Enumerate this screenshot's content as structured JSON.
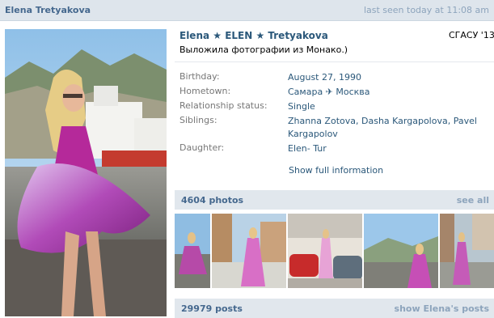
{
  "topbar": {
    "name": "Elena Tretyakova",
    "last_seen": "last seen today at 11:08 am"
  },
  "profile": {
    "full_name": "Elena ★ ELEN ★ Tretyakova",
    "university": "СГАСУ '13",
    "status": "Выложила фотографии из Монако.)"
  },
  "info": {
    "birthday_label": "Birthday:",
    "birthday_value": "August 27, 1990",
    "hometown_label": "Hometown:",
    "hometown_value": "Самара ✈ Москва",
    "relationship_label": "Relationship status:",
    "relationship_value": "Single",
    "siblings_label": "Siblings:",
    "siblings_1": "Zhanna Zotova",
    "siblings_sep1": ", ",
    "siblings_2": "Dasha Kargapolova",
    "siblings_sep2": ", ",
    "siblings_3": "Pavel Kargapolov",
    "daughter_label": "Daughter:",
    "daughter_value": "Elen- Tur",
    "show_full": "Show full information"
  },
  "photos": {
    "title": "4604 photos",
    "action": "see all"
  },
  "posts": {
    "title": "29979 posts",
    "action": "show Elena's posts"
  }
}
